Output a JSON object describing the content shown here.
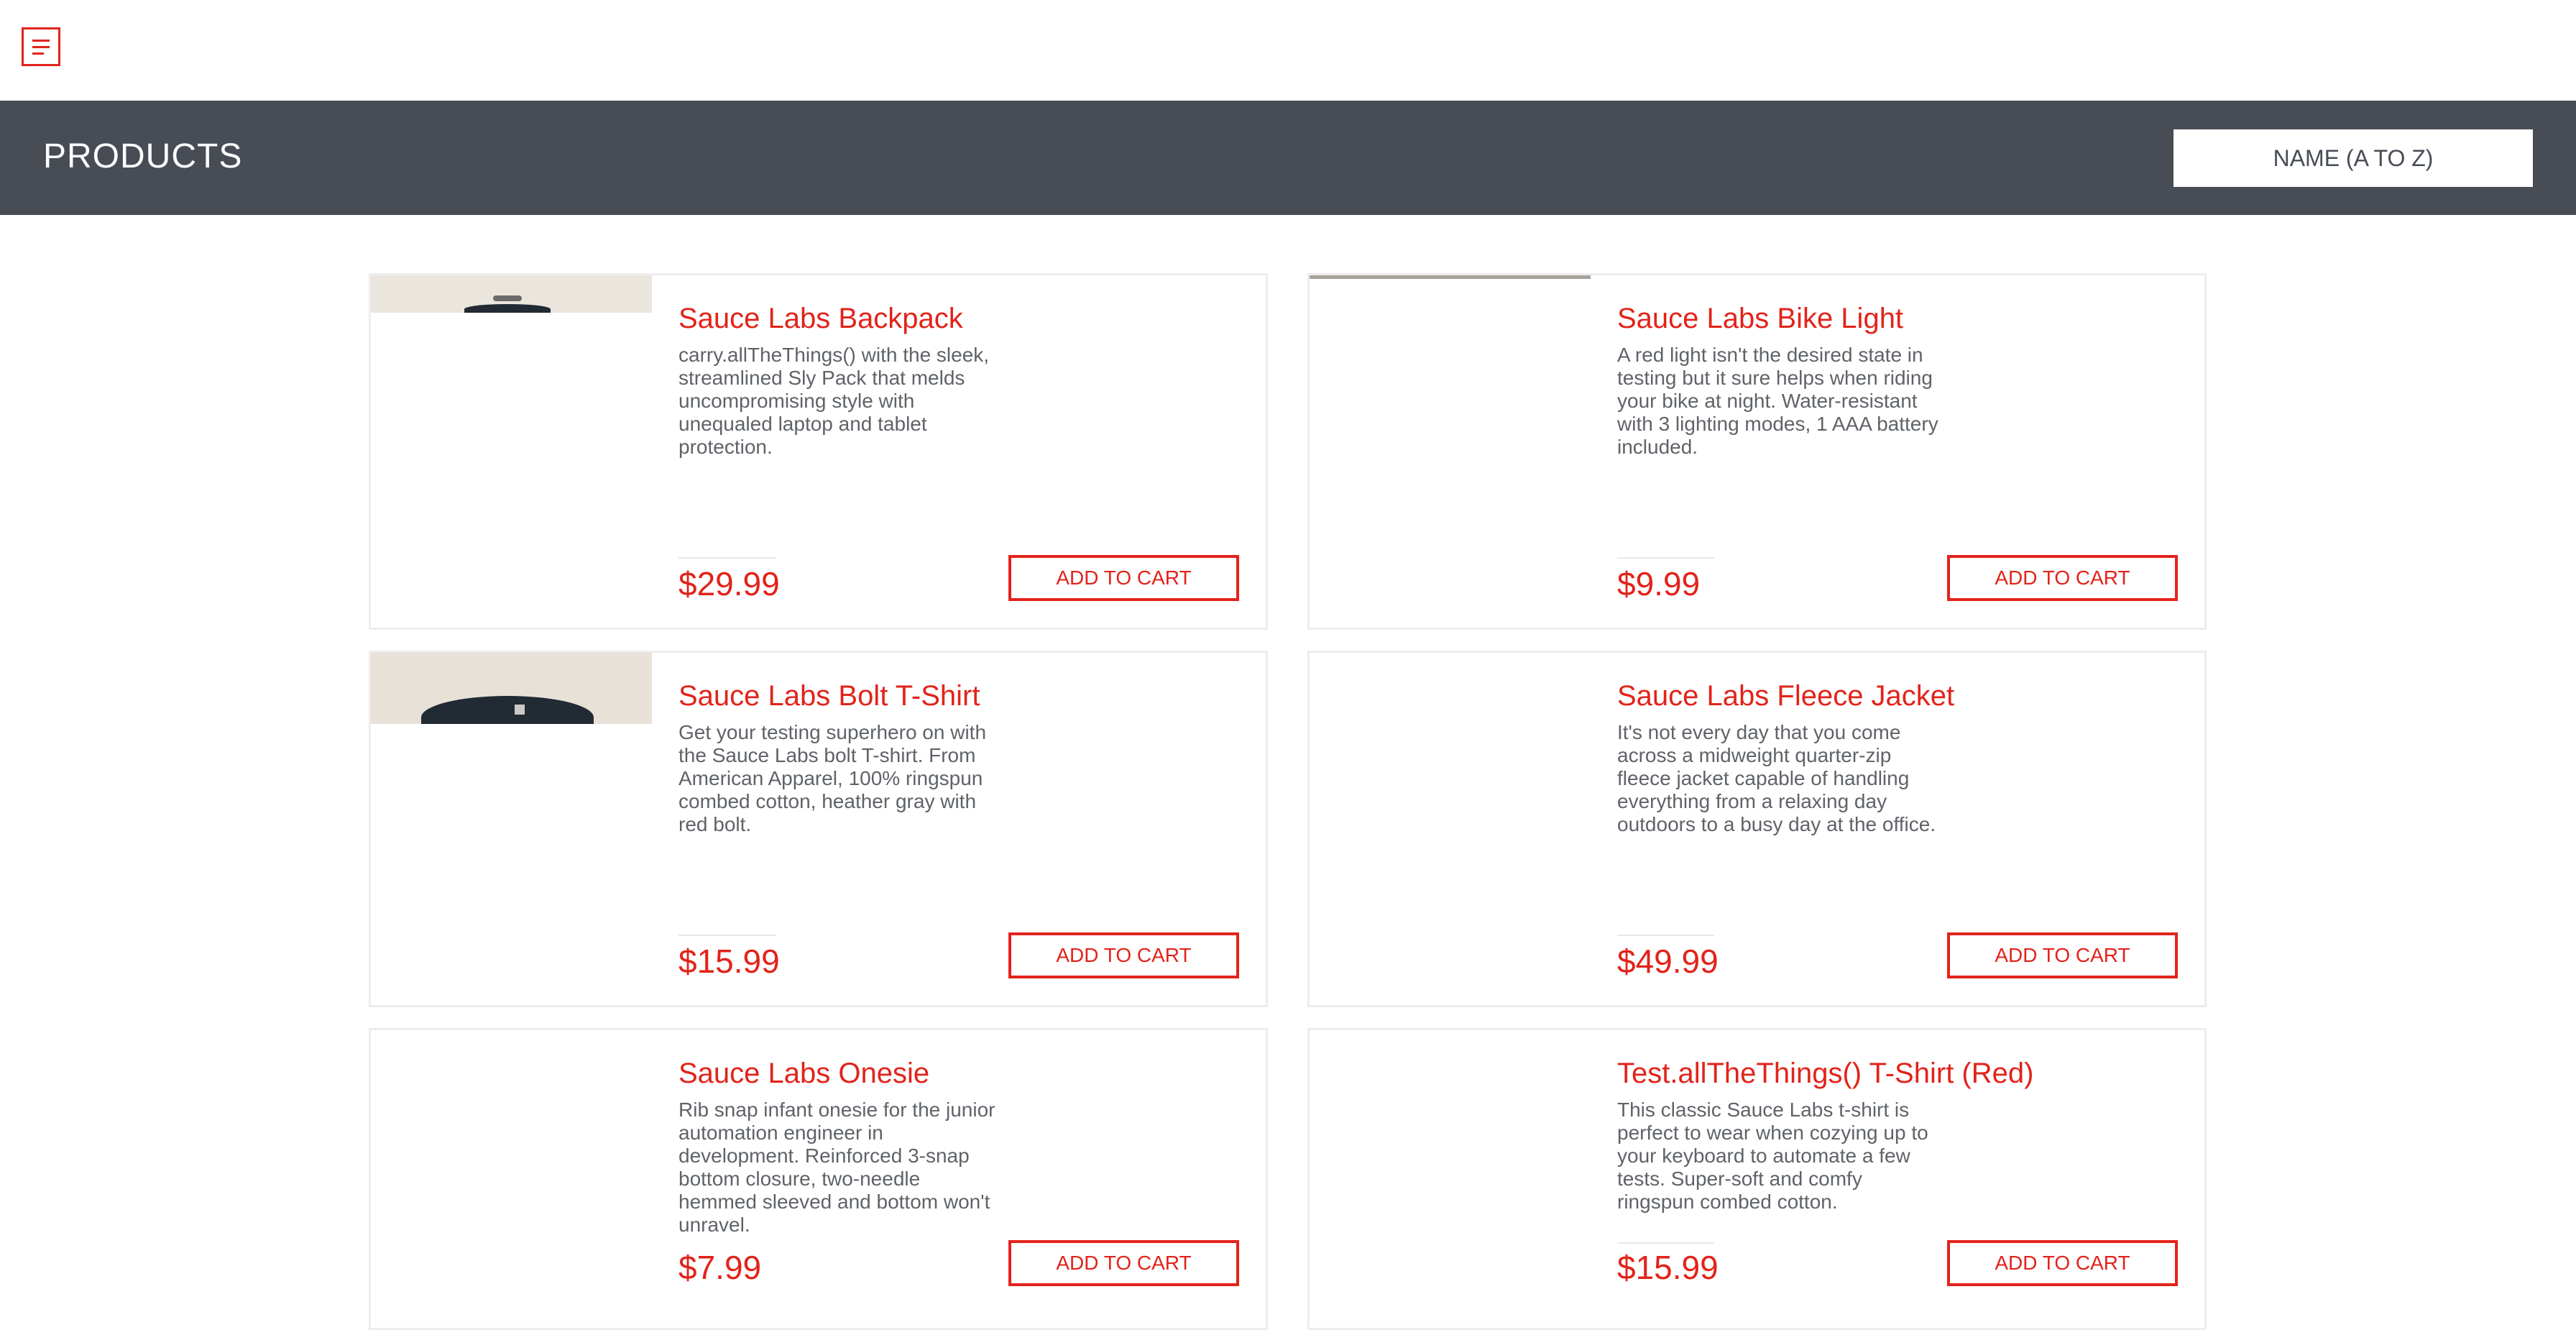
{
  "header": {
    "title": "PRODUCTS",
    "sort_selected": "NAME (A TO Z)"
  },
  "colors": {
    "accent": "#e2231a",
    "header_bg": "#474c55",
    "text_muted": "#5f6368"
  },
  "products": [
    {
      "name": "Sauce Labs Backpack",
      "description": "carry.allTheThings() with the sleek, streamlined Sly Pack that melds uncompromising style with unequaled laptop and tablet protection.",
      "price": "$29.99",
      "button": "ADD TO CART"
    },
    {
      "name": "Sauce Labs Bike Light",
      "description": "A red light isn't the desired state in testing but it sure helps when riding your bike at night. Water-resistant with 3 lighting modes, 1 AAA battery included.",
      "price": "$9.99",
      "button": "ADD TO CART"
    },
    {
      "name": "Sauce Labs Bolt T-Shirt",
      "description": "Get your testing superhero on with the Sauce Labs bolt T-shirt. From American Apparel, 100% ringspun combed cotton, heather gray with red bolt.",
      "price": "$15.99",
      "button": "ADD TO CART"
    },
    {
      "name": "Sauce Labs Fleece Jacket",
      "description": "It's not every day that you come across a midweight quarter-zip fleece jacket capable of handling everything from a relaxing day outdoors to a busy day at the office.",
      "price": "$49.99",
      "button": "ADD TO CART"
    },
    {
      "name": "Sauce Labs Onesie",
      "description": "Rib snap infant onesie for the junior automation engineer in development. Reinforced 3-snap bottom closure, two-needle hemmed sleeved and bottom won't unravel.",
      "price": "$7.99",
      "button": "ADD TO CART"
    },
    {
      "name": "Test.allTheThings() T-Shirt (Red)",
      "description": "This classic Sauce Labs t-shirt is perfect to wear when cozying up to your keyboard to automate a few tests. Super-soft and comfy ringspun combed cotton.",
      "price": "$15.99",
      "button": "ADD TO CART"
    }
  ]
}
